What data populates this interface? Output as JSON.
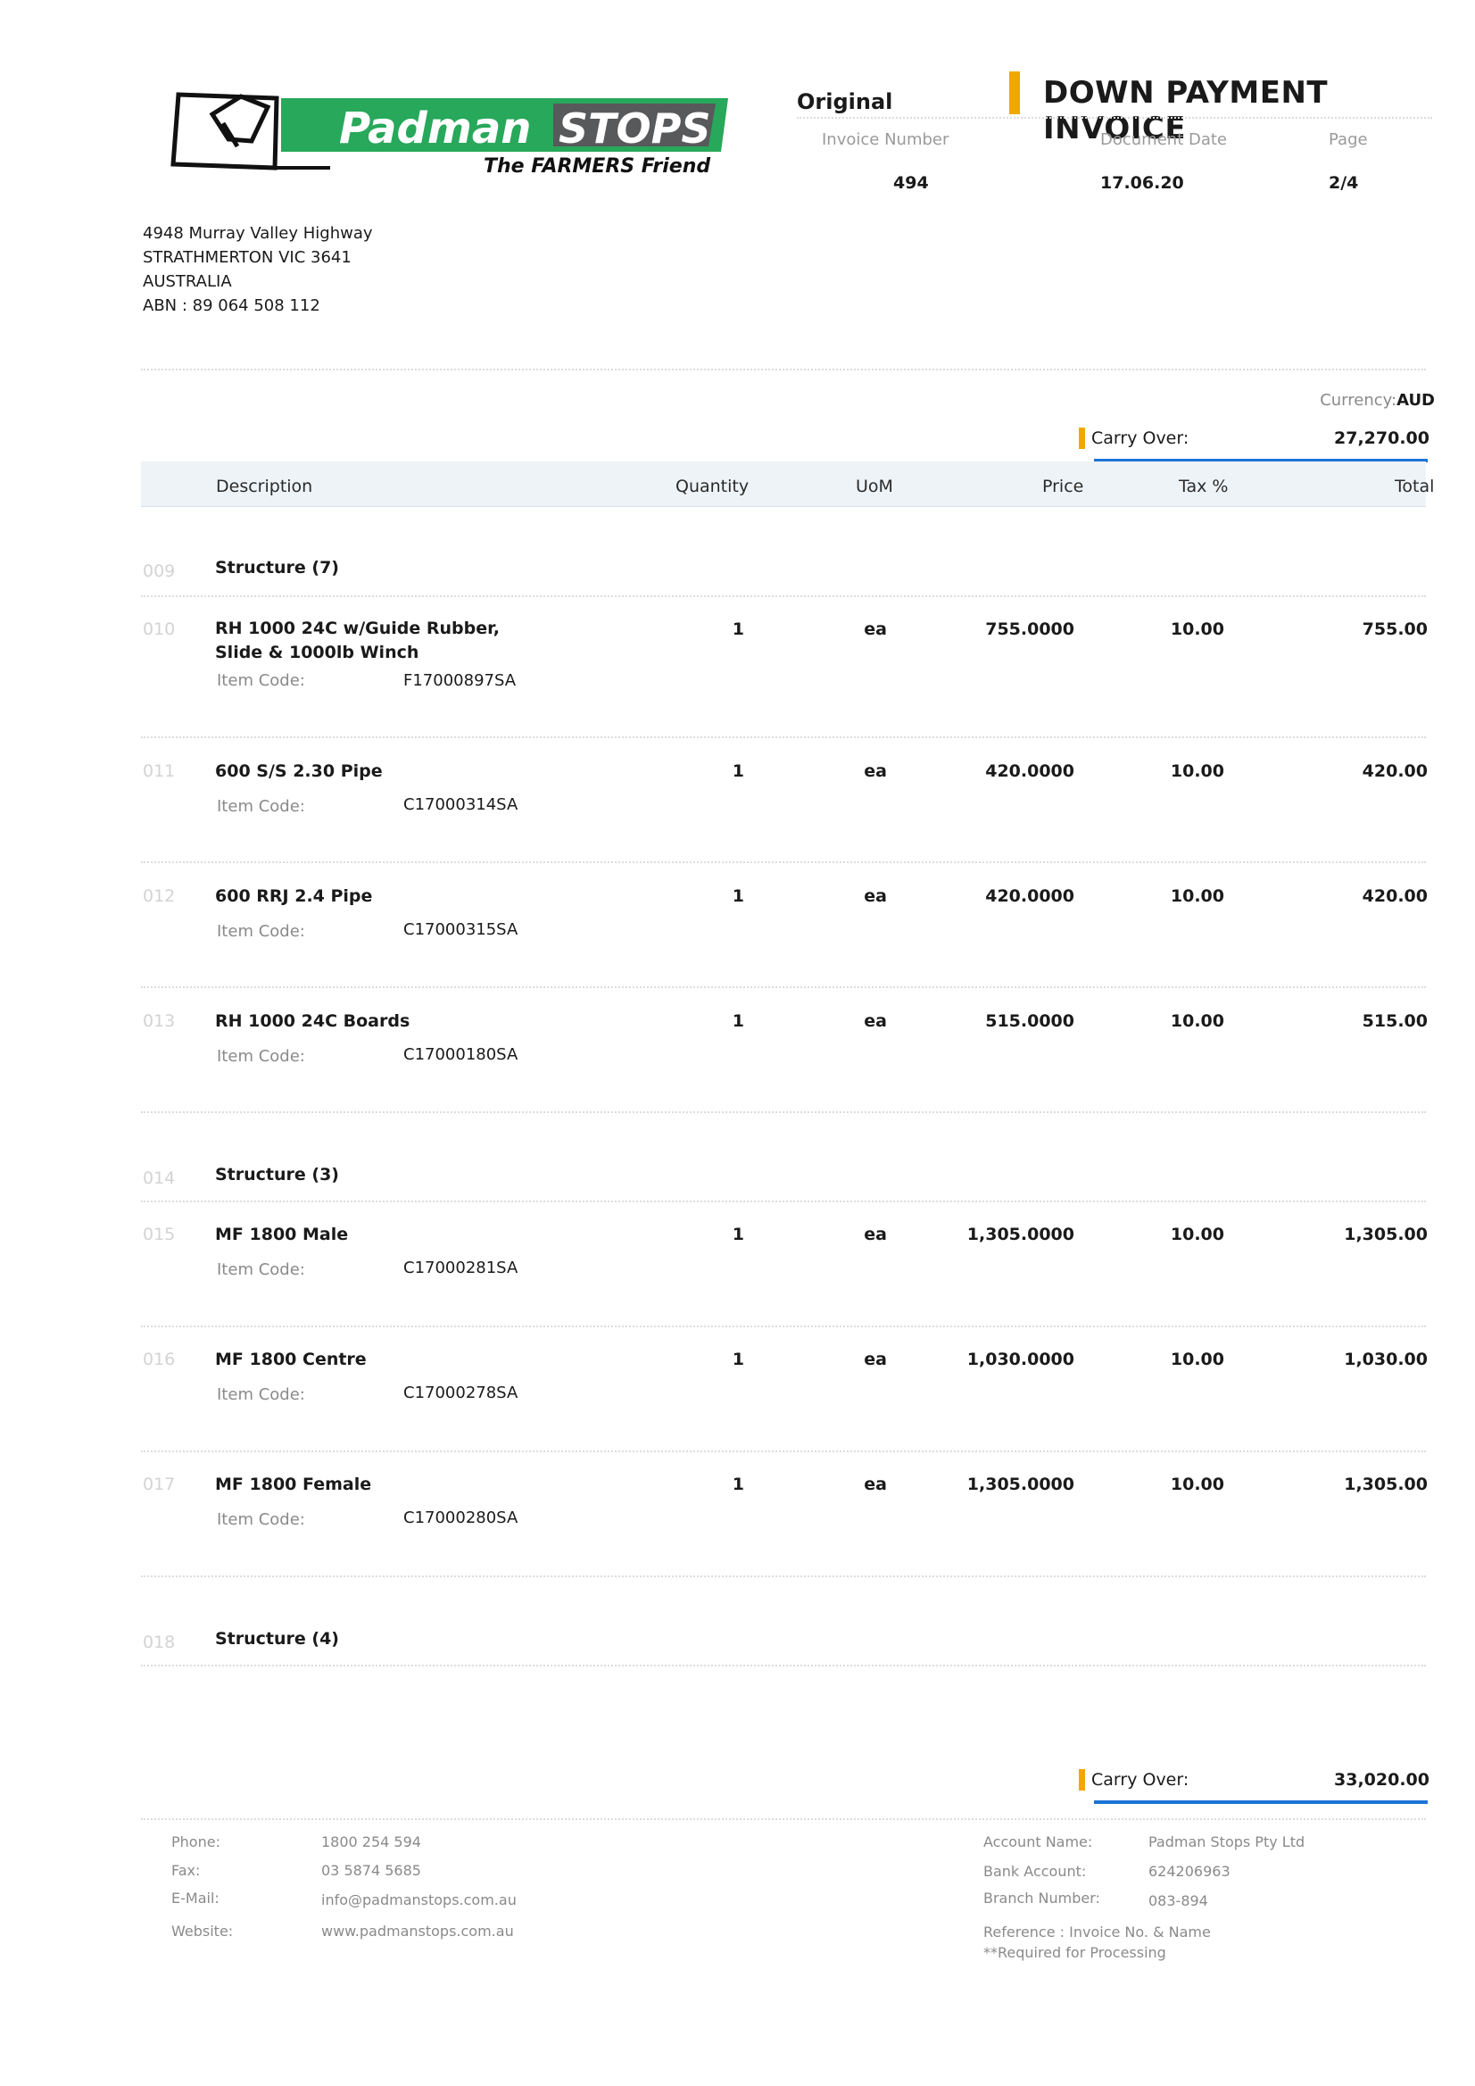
{
  "brand": {
    "name_part1": "Padman",
    "name_part2": "STOPS",
    "tagline": "The FARMERS Friend",
    "green": "#27a85a",
    "dark": "#58595b"
  },
  "header": {
    "status": "Original",
    "title": "DOWN PAYMENT INVOICE",
    "invoice_number_label": "Invoice Number",
    "invoice_number": "494",
    "document_date_label": "Document Date",
    "document_date": "17.06.20",
    "page_label": "Page",
    "page": "2/4"
  },
  "address": {
    "line1": "4948 Murray Valley Highway",
    "line2": "STRATHMERTON VIC 3641",
    "line3": "AUSTRALIA",
    "abn": "ABN : 89 064 508 112"
  },
  "currency": {
    "label": "Currency:",
    "value": "AUD"
  },
  "carry_over_top": {
    "label": "Carry Over:",
    "value": "27,270.00"
  },
  "table": {
    "headers": {
      "description": "Description",
      "quantity": "Quantity",
      "uom": "UoM",
      "price": "Price",
      "tax": "Tax %",
      "total": "Total"
    },
    "item_code_label": "Item Code:",
    "rows": [
      {
        "line": "009",
        "desc": "Structure (7)"
      },
      {
        "line": "010",
        "desc": "RH 1000 24C w/Guide Rubber,",
        "desc2": "Slide & 1000lb Winch",
        "code": "F17000897SA",
        "qty": "1",
        "uom": "ea",
        "price": "755.0000",
        "tax": "10.00",
        "total": "755.00"
      },
      {
        "line": "011",
        "desc": "600 S/S 2.30 Pipe",
        "code": "C17000314SA",
        "qty": "1",
        "uom": "ea",
        "price": "420.0000",
        "tax": "10.00",
        "total": "420.00"
      },
      {
        "line": "012",
        "desc": "600 RRJ 2.4 Pipe",
        "code": "C17000315SA",
        "qty": "1",
        "uom": "ea",
        "price": "420.0000",
        "tax": "10.00",
        "total": "420.00"
      },
      {
        "line": "013",
        "desc": "RH 1000 24C Boards",
        "code": "C17000180SA",
        "qty": "1",
        "uom": "ea",
        "price": "515.0000",
        "tax": "10.00",
        "total": "515.00"
      },
      {
        "line": "014",
        "desc": "Structure (3)"
      },
      {
        "line": "015",
        "desc": "MF 1800 Male",
        "code": "C17000281SA",
        "qty": "1",
        "uom": "ea",
        "price": "1,305.0000",
        "tax": "10.00",
        "total": "1,305.00"
      },
      {
        "line": "016",
        "desc": "MF 1800 Centre",
        "code": "C17000278SA",
        "qty": "1",
        "uom": "ea",
        "price": "1,030.0000",
        "tax": "10.00",
        "total": "1,030.00"
      },
      {
        "line": "017",
        "desc": "MF 1800 Female",
        "code": "C17000280SA",
        "qty": "1",
        "uom": "ea",
        "price": "1,305.0000",
        "tax": "10.00",
        "total": "1,305.00"
      },
      {
        "line": "018",
        "desc": "Structure (4)"
      }
    ]
  },
  "carry_over_bottom": {
    "label": "Carry Over:",
    "value": "33,020.00"
  },
  "footer": {
    "phone_label": "Phone:",
    "phone": "1800 254 594",
    "fax_label": "Fax:",
    "fax": "03 5874 5685",
    "email_label": "E-Mail:",
    "email": "info@padmanstops.com.au",
    "website_label": "Website:",
    "website": "www.padmanstops.com.au",
    "account_name_label": "Account Name:",
    "account_name": "Padman Stops Pty Ltd",
    "bank_account_label": "Bank Account:",
    "bank_account": "624206963",
    "branch_label": "Branch Number:",
    "branch": "083-894",
    "reference": "Reference : Invoice No. & Name",
    "required": "**Required for Processing"
  }
}
